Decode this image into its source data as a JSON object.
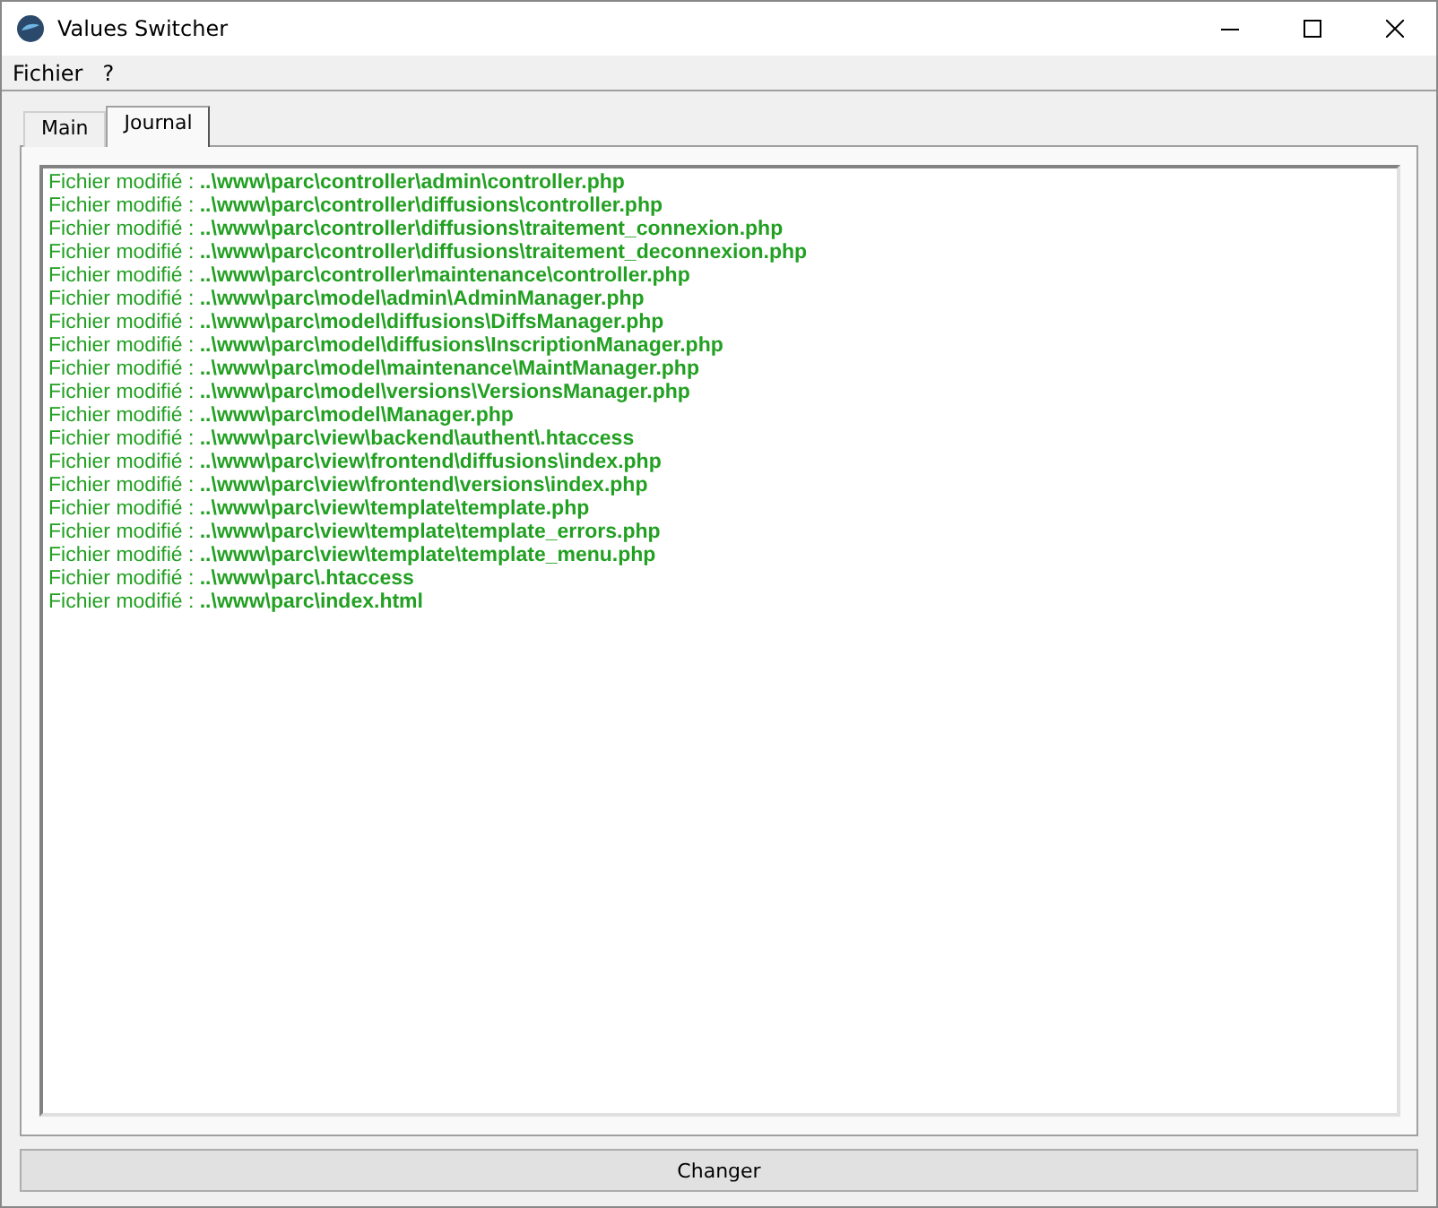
{
  "window": {
    "title": "Values Switcher"
  },
  "menu": [
    "Fichier",
    "?"
  ],
  "tabs": [
    {
      "label": "Main",
      "selected": false
    },
    {
      "label": "Journal",
      "selected": true
    }
  ],
  "journal": [
    "Fichier modifié : **..\\www\\parc\\controller\\admin\\controller.php**",
    "Fichier modifié : **..\\www\\parc\\controller\\diffusions\\controller.php**",
    "Fichier modifié : **..\\www\\parc\\controller\\diffusions\\traitement_connexion.php**",
    "Fichier modifié : **..\\www\\parc\\controller\\diffusions\\traitement_deconnexion.php**",
    "Fichier modifié : **..\\www\\parc\\controller\\maintenance\\controller.php**",
    "Fichier modifié : **..\\www\\parc\\model\\admin\\AdminManager.php**",
    "Fichier modifié : **..\\www\\parc\\model\\diffusions\\DiffsManager.php**",
    "Fichier modifié : **..\\www\\parc\\model\\diffusions\\InscriptionManager.php**",
    "Fichier modifié : **..\\www\\parc\\model\\maintenance\\MaintManager.php**",
    "Fichier modifié : **..\\www\\parc\\model\\versions\\VersionsManager.php**",
    "Fichier modifié : **..\\www\\parc\\model\\Manager.php**",
    "Fichier modifié : **..\\www\\parc\\view\\backend\\authent\\.htaccess**",
    "Fichier modifié : **..\\www\\parc\\view\\frontend\\diffusions\\index.php**",
    "Fichier modifié : **..\\www\\parc\\view\\frontend\\versions\\index.php**",
    "Fichier modifié : **..\\www\\parc\\view\\template\\template.php**",
    "Fichier modifié : **..\\www\\parc\\view\\template\\template_errors.php**",
    "Fichier modifié : **..\\www\\parc\\view\\template\\template_menu.php**",
    "Fichier modifié : **..\\www\\parc\\.htaccess**",
    "Fichier modifié : **..\\www\\parc\\index.html**"
  ],
  "button": "Changer"
}
